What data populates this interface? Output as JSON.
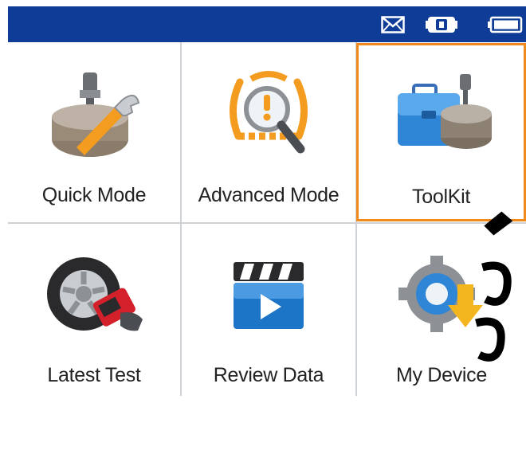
{
  "status_bar": {
    "icons": [
      "mail-icon",
      "vehicle-communication-icon",
      "battery-icon"
    ],
    "background": "#0e3c96"
  },
  "menu": {
    "tiles": [
      {
        "label": "Quick Mode",
        "icon": "tpms-sensor-wrench-icon"
      },
      {
        "label": "Advanced Mode",
        "icon": "tpms-warning-magnifier-icon"
      },
      {
        "label": "ToolKit",
        "icon": "toolbox-sensor-icon",
        "selected": true
      },
      {
        "label": "Latest Test",
        "icon": "tire-tool-icon"
      },
      {
        "label": "Review Data",
        "icon": "clapperboard-play-icon"
      },
      {
        "label": "My Device",
        "icon": "gear-download-icon"
      }
    ],
    "selection_color": "#f08a1a"
  }
}
